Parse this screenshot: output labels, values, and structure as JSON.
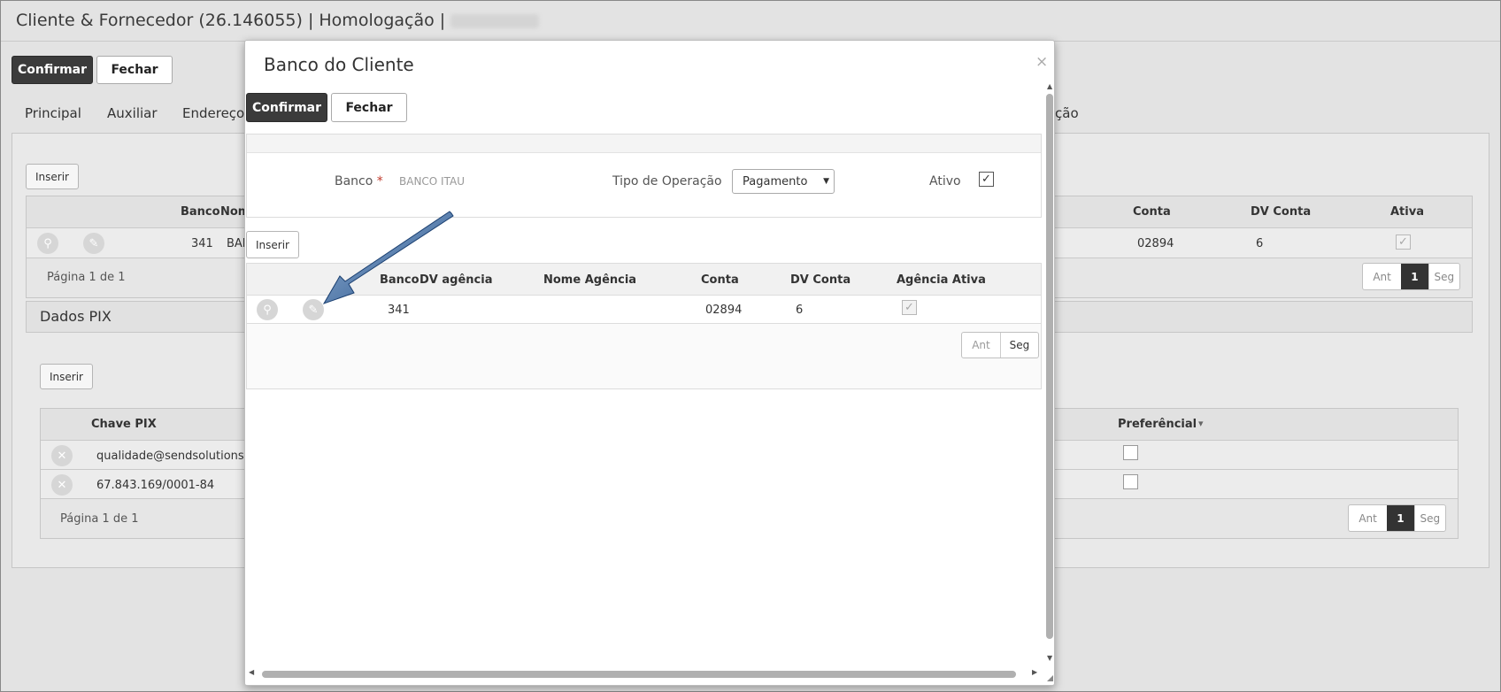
{
  "window": {
    "title": "Cliente & Fornecedor (26.146055) | Homologação |"
  },
  "toolbar": {
    "confirm_label": "Confirmar",
    "close_label": "Fechar"
  },
  "tabs": [
    {
      "label": "Principal"
    },
    {
      "label": "Auxiliar"
    },
    {
      "label": "Endereços"
    },
    {
      "label": "ção"
    }
  ],
  "bank_section": {
    "insert_label": "Inserir",
    "columns": [
      "Banco",
      "Nom",
      "Conta",
      "DV Conta",
      "Ativa"
    ],
    "row": {
      "banco": "341",
      "nome": "BAN",
      "conta": "02894",
      "dv_conta": "6",
      "ativa": "✓"
    },
    "pagination_text": "Página 1 de 1",
    "pager": {
      "prev": "Ant",
      "current": "1",
      "next": "Seg"
    }
  },
  "pix_section": {
    "title": "Dados PIX",
    "insert_label": "Inserir",
    "columns": [
      "Chave PIX",
      "Preferêncial"
    ],
    "sort_icon": "▾",
    "rows": [
      {
        "chave": "qualidade@sendsolutions.co"
      },
      {
        "chave": "67.843.169/0001-84"
      }
    ],
    "pagination_text": "Página 1 de 1",
    "pager": {
      "prev": "Ant",
      "current": "1",
      "next": "Seg"
    }
  },
  "modal": {
    "title": "Banco do Cliente",
    "close_icon": "×",
    "confirm_label": "Confirmar",
    "close_label": "Fechar",
    "form": {
      "banco_label": "Banco",
      "required_mark": "*",
      "banco_value": "BANCO ITAU",
      "tipo_label": "Tipo de Operação",
      "tipo_value": "Pagamento",
      "ativo_label": "Ativo",
      "ativo_checked": "✓"
    },
    "agencias": {
      "insert_label": "Inserir",
      "columns": [
        "Banco",
        "DV agência",
        "Nome Agência",
        "Conta",
        "DV Conta",
        "Agência Ativa"
      ],
      "row": {
        "banco": "341",
        "conta": "02894",
        "dv_conta": "6",
        "ativa": "✓"
      },
      "pager": {
        "prev": "Ant",
        "next": "Seg"
      }
    }
  },
  "icons": {
    "search": "search-icon",
    "edit": "pencil-icon",
    "remove": "x-circle-icon"
  },
  "colors": {
    "dark_button": "#3b3b3b",
    "annotation_arrow": "#1f4f8a"
  }
}
